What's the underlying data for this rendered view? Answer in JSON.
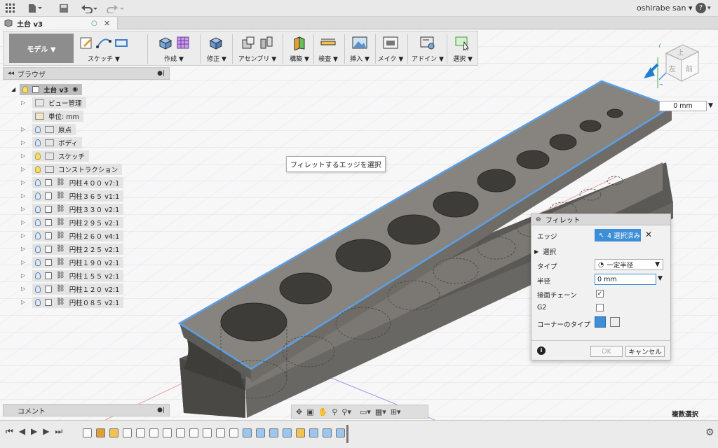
{
  "titlebar": {
    "user": "oshirabe san",
    "help_label": "?"
  },
  "document_tab": {
    "title": "土台 v3"
  },
  "toolbar": {
    "workspace": "モデル ▼",
    "groups": [
      {
        "label": "スケッチ ▼"
      },
      {
        "label": "作成 ▼"
      },
      {
        "label": "修正 ▼"
      },
      {
        "label": "アセンブリ ▼"
      },
      {
        "label": "構築 ▼"
      },
      {
        "label": "検査 ▼"
      },
      {
        "label": "挿入 ▼"
      },
      {
        "label": "メイク ▼"
      },
      {
        "label": "アドイン ▼"
      },
      {
        "label": "選択 ▼"
      }
    ]
  },
  "browser": {
    "title": "ブラウザ",
    "root": "土台 v3",
    "items": [
      {
        "label": "ビュー管理"
      },
      {
        "label": "単位: mm"
      },
      {
        "label": "原点"
      },
      {
        "label": "ボディ"
      },
      {
        "label": "スケッチ"
      },
      {
        "label": "コンストラクション"
      },
      {
        "label": "円柱４００ v7:1"
      },
      {
        "label": "円柱３６５ v1:1"
      },
      {
        "label": "円柱３３０ v2:1"
      },
      {
        "label": "円柱２９５ v2:1"
      },
      {
        "label": "円柱２６０ v4:1"
      },
      {
        "label": "円柱２２５ v2:1"
      },
      {
        "label": "円柱１９０ v2:1"
      },
      {
        "label": "円柱１５５ v2:1"
      },
      {
        "label": "円柱１２０ v2:1"
      },
      {
        "label": "円柱０８５ v2:1"
      }
    ]
  },
  "tooltip": "フィレットするエッジを選択",
  "distance_field": "0 mm",
  "viewcube": {
    "top": "上",
    "left": "左",
    "front": "前"
  },
  "fillet_dialog": {
    "title": "フィレット",
    "edge_label": "エッジ",
    "edge_value": "4 選択済み",
    "select_section": "選択",
    "type_label": "タイプ",
    "type_value": "一定半径",
    "radius_label": "半径",
    "radius_value": "0 mm",
    "tangent_label": "接面チェーン",
    "tangent_checked": true,
    "g2_label": "G2",
    "g2_checked": false,
    "corner_label": "コーナーのタイプ",
    "ok_label": "OK",
    "cancel_label": "キャンセル"
  },
  "comment_panel": {
    "title": "コメント"
  },
  "status": {
    "multi_select": "複数選択"
  },
  "colors": {
    "accent": "#3c8fd6",
    "body": "#6c6a66",
    "selection": "#5aa0e6"
  }
}
